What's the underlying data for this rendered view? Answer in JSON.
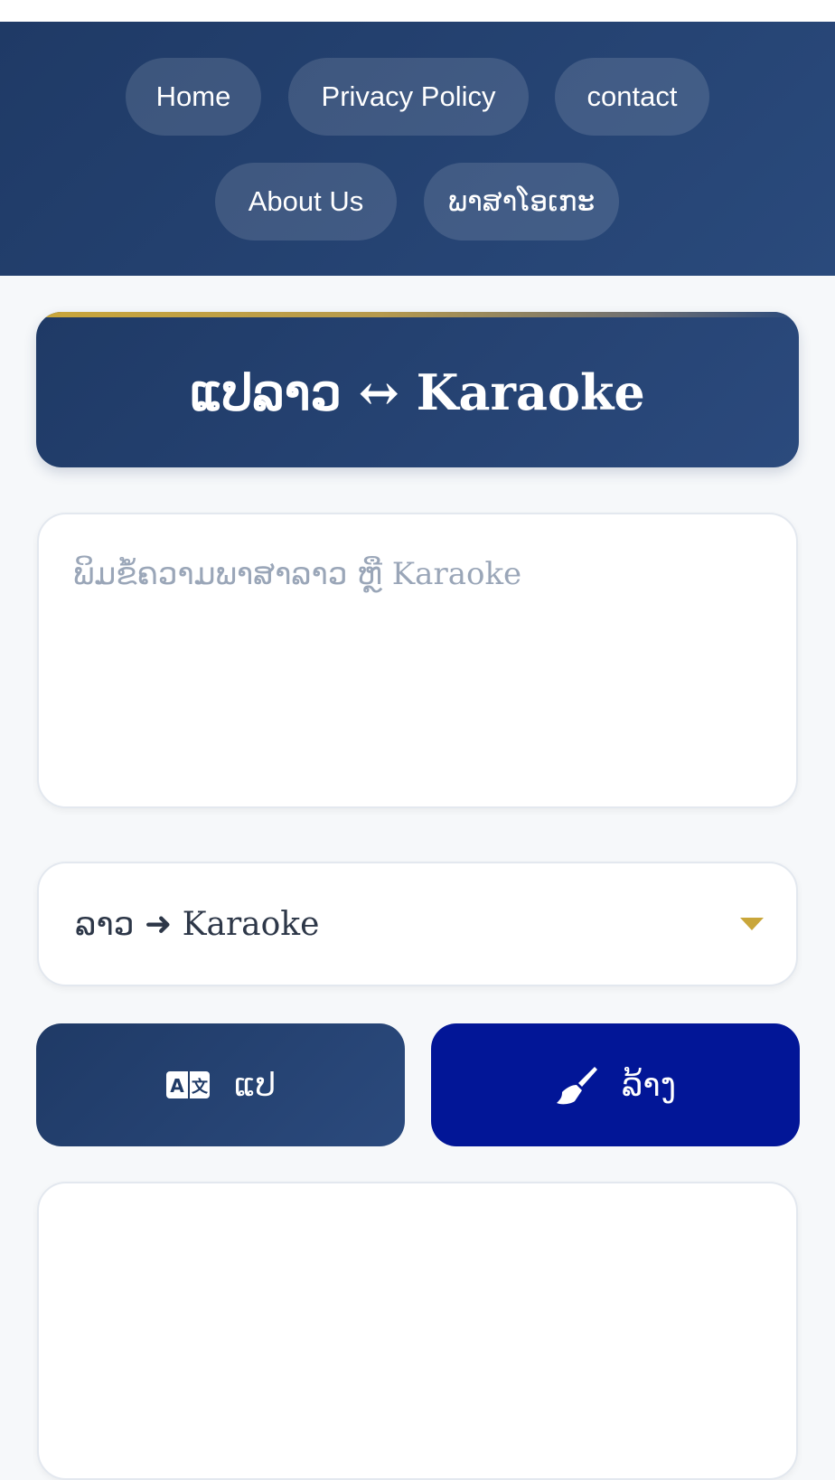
{
  "nav": {
    "items": [
      {
        "label": "Home"
      },
      {
        "label": "Privacy Policy"
      },
      {
        "label": "contact"
      },
      {
        "label": "About Us"
      },
      {
        "label": "ພາສາໂອເກະ"
      }
    ]
  },
  "title": "ແປລາວ ↔ Karaoke",
  "input": {
    "placeholder": "ພິມຂໍ້ຄວາມພາສາລາວ ຫຼື Karaoke",
    "value": ""
  },
  "direction_select": {
    "selected": "ລາວ ➜ Karaoke"
  },
  "buttons": {
    "translate_label": "ແປ",
    "clear_label": "ລ້າງ"
  },
  "output": {
    "text": ""
  },
  "colors": {
    "primary": "#1f3a66",
    "accent": "#c9a63a",
    "clear_button": "#021697",
    "background": "#f6f8fa"
  },
  "icons": {
    "translate": "translate-icon",
    "clear": "broom-icon",
    "dropdown": "chevron-down-icon"
  }
}
